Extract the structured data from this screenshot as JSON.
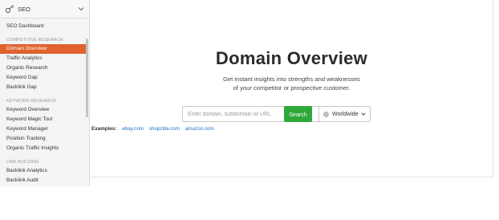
{
  "sidebar": {
    "header_title": "SEO",
    "items": [
      {
        "label": "SEO Dashboard"
      }
    ],
    "sections": [
      {
        "title": "COMPETITIVE RESEARCH",
        "items": [
          {
            "label": "Domain Overview",
            "active": true
          },
          {
            "label": "Traffic Analytics"
          },
          {
            "label": "Organic Research"
          },
          {
            "label": "Keyword Gap"
          },
          {
            "label": "Backlink Gap"
          }
        ]
      },
      {
        "title": "KEYWORD RESEARCH",
        "items": [
          {
            "label": "Keyword Overview"
          },
          {
            "label": "Keyword Magic Tool"
          },
          {
            "label": "Keyword Manager"
          },
          {
            "label": "Position Tracking"
          },
          {
            "label": "Organic Traffic Insights"
          }
        ]
      },
      {
        "title": "LINK BUILDING",
        "items": [
          {
            "label": "Backlink Analytics"
          },
          {
            "label": "Backlink Audit"
          }
        ]
      }
    ]
  },
  "main": {
    "title": "Domain Overview",
    "subtitle_line1": "Get instant insights into strengths and weaknesses",
    "subtitle_line2": "of your competitor or prospective customer.",
    "search": {
      "placeholder": "Enter domain, subdomain or URL",
      "database_label": "Worldwide",
      "button_label": "Search"
    },
    "examples": {
      "label": "Examples:",
      "links": [
        "ebay.com",
        "shopzilla.com",
        "amazon.com"
      ]
    }
  },
  "colors": {
    "accent_active": "#e0622d",
    "search_button": "#2fa83a",
    "link": "#1a73c9"
  }
}
